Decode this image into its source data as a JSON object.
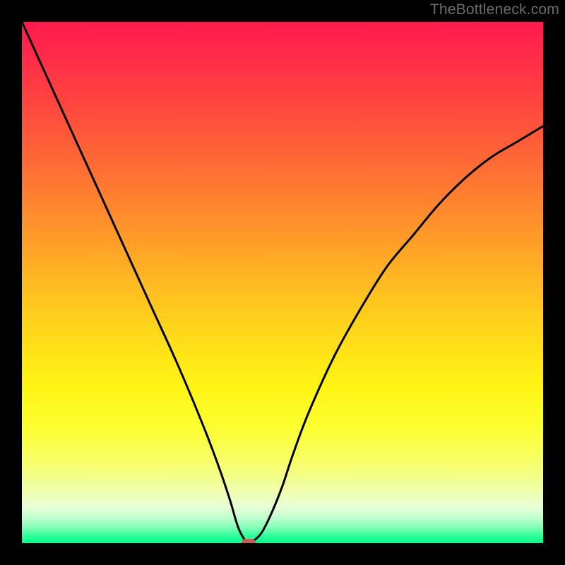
{
  "watermark": "TheBottleneck.com",
  "chart_data": {
    "type": "line",
    "title": "",
    "xlabel": "",
    "ylabel": "",
    "xlim": [
      0,
      100
    ],
    "ylim": [
      0,
      100
    ],
    "x": [
      0,
      5,
      10,
      15,
      20,
      25,
      30,
      35,
      38,
      40,
      41.5,
      43,
      43.5,
      44.5,
      46,
      48,
      50,
      52,
      55,
      60,
      65,
      70,
      75,
      80,
      85,
      90,
      95,
      100
    ],
    "values": [
      100,
      89,
      78,
      67,
      56,
      45,
      34,
      22,
      14,
      8,
      3,
      0.2,
      0,
      0.5,
      2,
      6,
      11,
      17,
      25,
      36,
      45,
      53,
      59,
      65,
      70,
      74,
      77,
      80
    ],
    "minimum_point": {
      "x": 43.5,
      "y": 0
    },
    "gradient_stops": [
      {
        "pos": 0,
        "color": "#ff1a4d"
      },
      {
        "pos": 50,
        "color": "#ffd000"
      },
      {
        "pos": 100,
        "color": "#00ff88"
      }
    ]
  }
}
